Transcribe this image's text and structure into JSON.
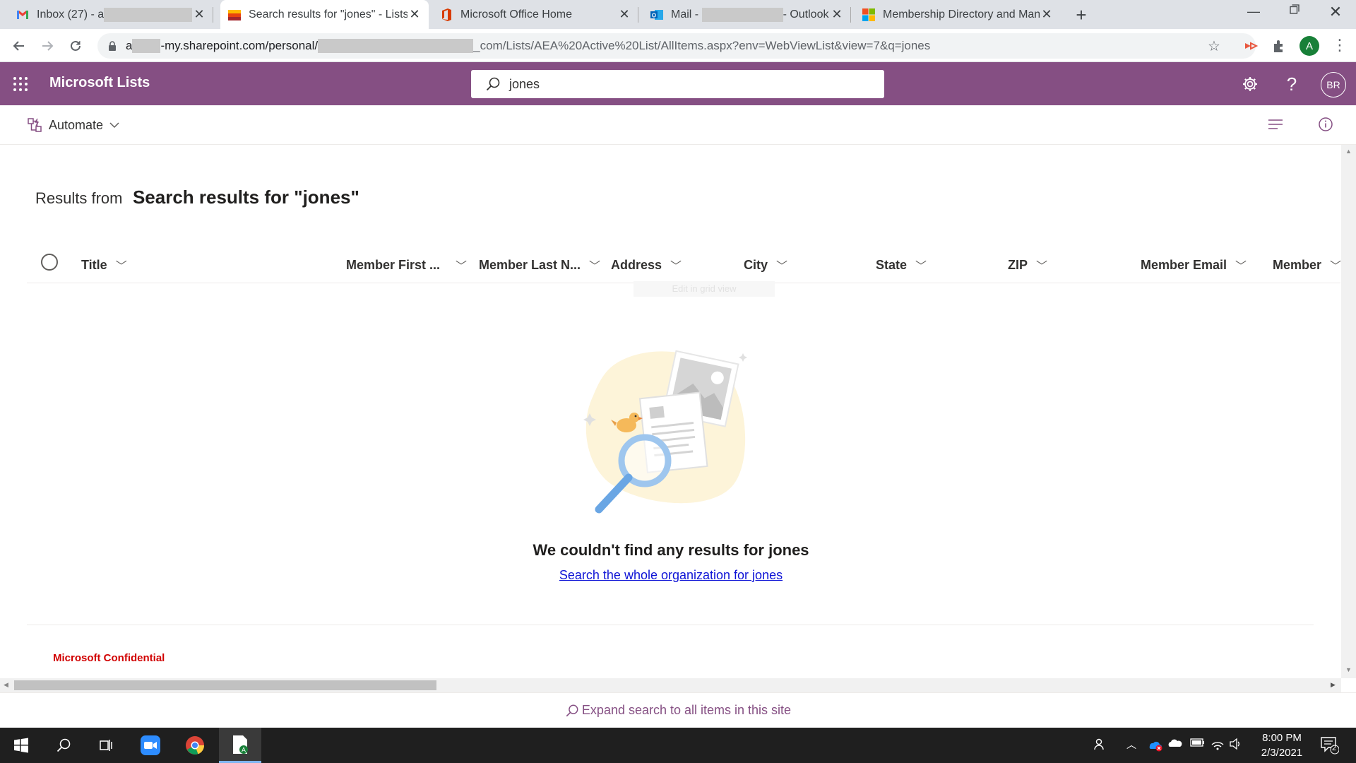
{
  "browser": {
    "tabs": [
      {
        "title": "Inbox (27) - a",
        "icon": "gmail-icon"
      },
      {
        "title": "Search results for \"jones\" - Lists",
        "icon": "lists-icon"
      },
      {
        "title": "Microsoft Office Home",
        "icon": "office-icon"
      },
      {
        "title": "Mail - ",
        "title_tail": "- Outlook",
        "icon": "outlook-icon"
      },
      {
        "title": "Membership Directory and Mana",
        "icon": "microsoft-icon"
      }
    ],
    "active_tab_index": 1,
    "url": {
      "prefix": "a",
      "host": "-my.sharepoint.com/personal/",
      "rest": "_com/Lists/AEA%20Active%20List/AllItems.aspx?env=WebViewList&view=7&q=jones"
    },
    "profile_initial": "A"
  },
  "suite": {
    "app_name": "Microsoft Lists",
    "search_value": "jones",
    "user_initials": "BR",
    "brand_color": "#854f83"
  },
  "command_bar": {
    "automate_label": "Automate"
  },
  "results": {
    "from_label": "Results from",
    "title": "Search results for \"jones\""
  },
  "columns": [
    "Title",
    "Member First ...",
    "Member Last N...",
    "Address",
    "City",
    "State",
    "ZIP",
    "Member Email",
    "Member"
  ],
  "ghost_text": "Edit in grid view",
  "empty_state": {
    "message": "We couldn't find any results for jones",
    "link": "Search the whole organization for jones"
  },
  "footer": {
    "confidential": "Microsoft Confidential",
    "expand_search": "Expand search to all items in this site"
  },
  "taskbar": {
    "time": "8:00 PM",
    "date": "2/3/2021",
    "notification_count": "2"
  }
}
